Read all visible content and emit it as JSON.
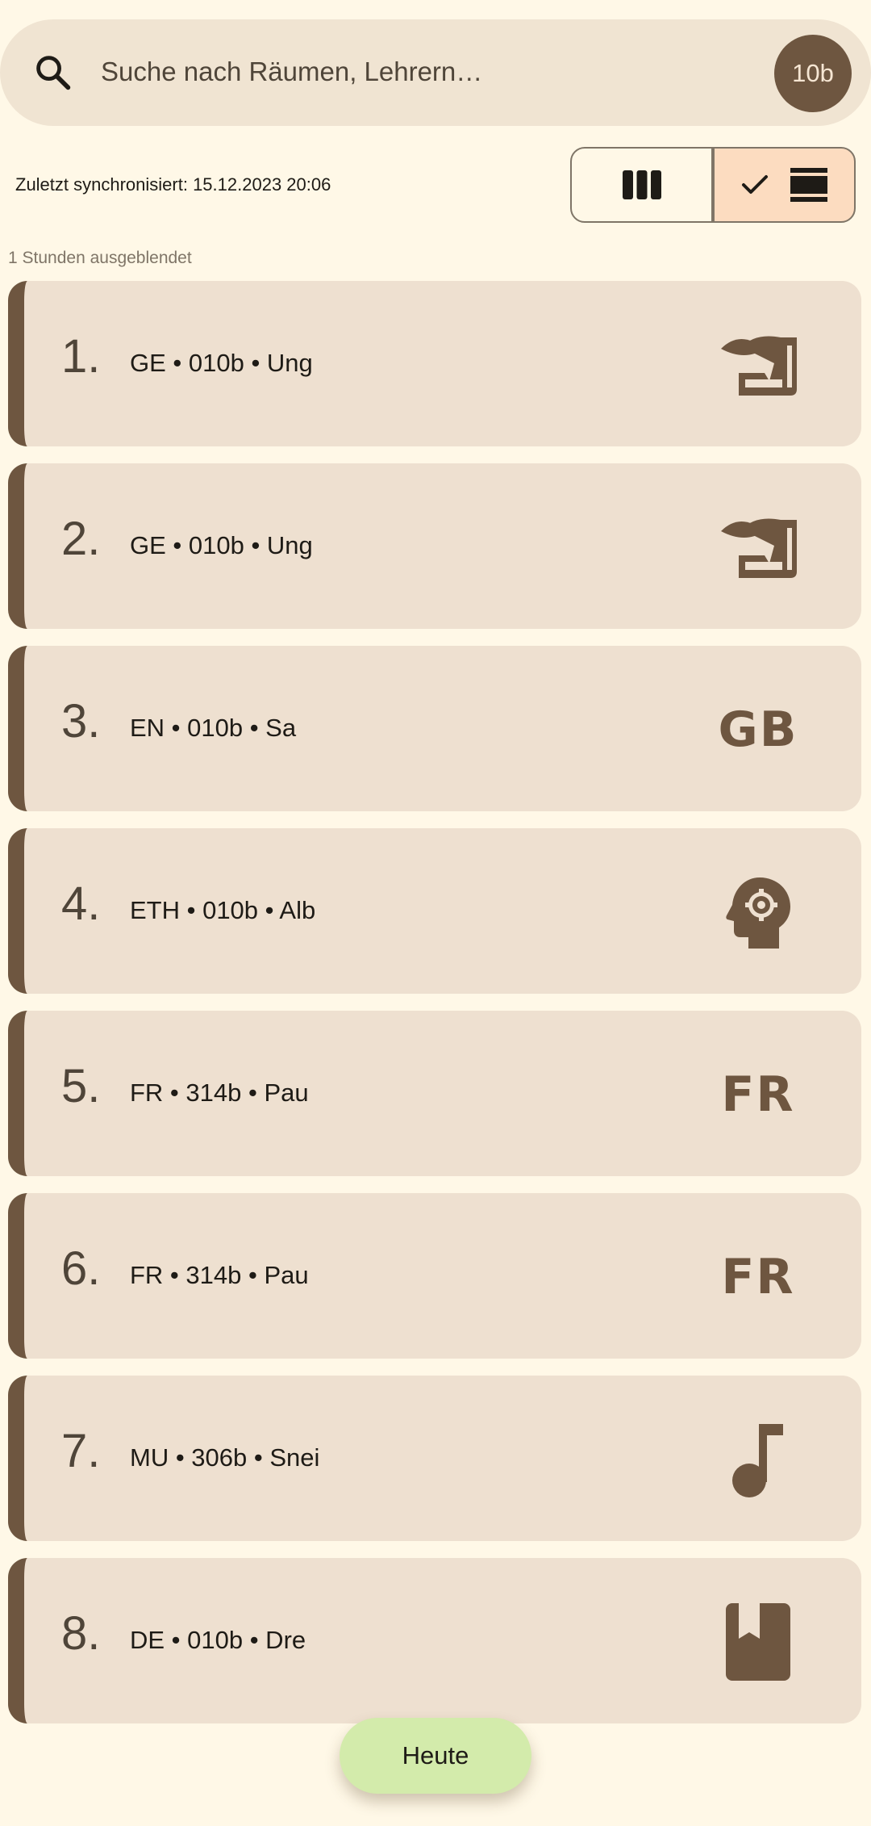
{
  "search": {
    "placeholder": "Suche nach Räumen, Lehrern…",
    "class_badge": "10b"
  },
  "sync_status": "Zuletzt synchronisiert: 15.12.2023 20:06",
  "view_toggle": {
    "options": [
      {
        "id": "columns",
        "icon": "view-columns-icon",
        "selected": false
      },
      {
        "id": "list",
        "icon": "view-agenda-icon",
        "selected": true
      }
    ]
  },
  "hidden_info": "1 Stunden ausgeblendet",
  "lessons": [
    {
      "number": "1.",
      "info": "GE • 010b • Ung",
      "icon": "history-edu-icon"
    },
    {
      "number": "2.",
      "info": "GE • 010b • Ung",
      "icon": "history-edu-icon"
    },
    {
      "number": "3.",
      "info": "EN • 010b • Sa",
      "icon": "text-icon",
      "icon_text": "GB"
    },
    {
      "number": "4.",
      "info": "ETH • 010b • Alb",
      "icon": "psychology-icon"
    },
    {
      "number": "5.",
      "info": "FR • 314b • Pau",
      "icon": "text-icon",
      "icon_text": "FR"
    },
    {
      "number": "6.",
      "info": "FR • 314b • Pau",
      "icon": "text-icon",
      "icon_text": "FR"
    },
    {
      "number": "7.",
      "info": "MU • 306b • Snei",
      "icon": "music-note-icon"
    },
    {
      "number": "8.",
      "info": "DE • 010b • Dre",
      "icon": "book-icon"
    }
  ],
  "today_button": "Heute",
  "colors": {
    "background": "#fff8e7",
    "card": "#eee0d0",
    "accent": "#6e5640",
    "toggle_selected": "#fcdcc0",
    "fab": "#d3ebab"
  }
}
